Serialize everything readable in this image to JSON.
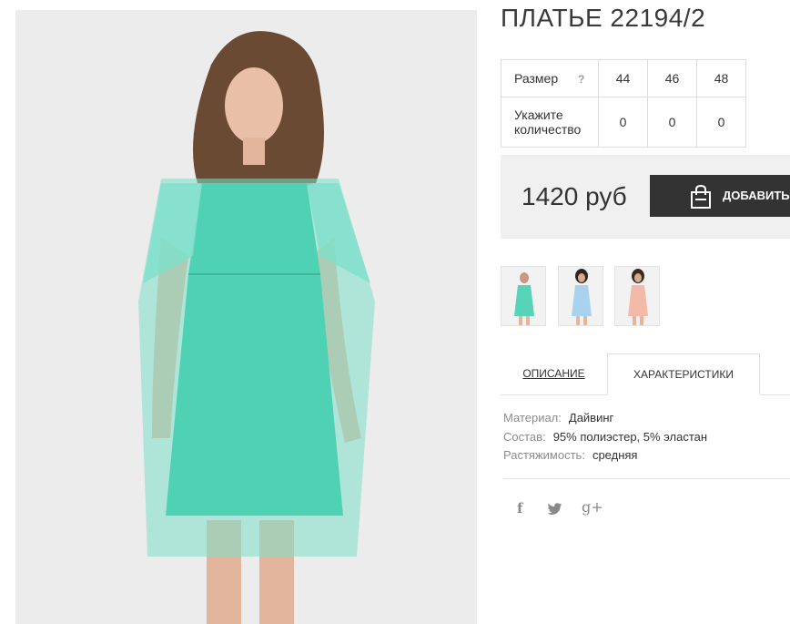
{
  "product": {
    "title": "ПЛАТЬЕ 22194/2",
    "price": "1420 руб",
    "add_button_label": "ДОБАВИТЬ В КОРЗИНУ"
  },
  "size_table": {
    "size_label": "Размер",
    "help_label": "?",
    "quantity_label_line1": "Укажите",
    "quantity_label_line2": "количество",
    "sizes": [
      "44",
      "46",
      "48"
    ],
    "quantities": [
      "0",
      "0",
      "0"
    ]
  },
  "thumbnails": [
    {
      "name": "thumb-mint-dress",
      "color": "#57d4b7"
    },
    {
      "name": "thumb-blue-dress",
      "color": "#a9d2ee"
    },
    {
      "name": "thumb-pink-dress",
      "color": "#f3b9a9"
    }
  ],
  "tabs": {
    "description": "ОПИСАНИЕ",
    "characteristics": "ХАРАКТЕРИСТИКИ",
    "active": "characteristics"
  },
  "characteristics": [
    {
      "key": "Материал:",
      "value": "Дайвинг"
    },
    {
      "key": "Состав:",
      "value": "95% полиэстер, 5% эластан"
    },
    {
      "key": "Растяжимость:",
      "value": "средняя"
    }
  ],
  "social": {
    "facebook": "f",
    "twitter": "🐦",
    "google_plus": "g+"
  },
  "colors": {
    "dress": "#4fd1b4",
    "button": "#333333",
    "price_box": "#f0f0f0"
  }
}
